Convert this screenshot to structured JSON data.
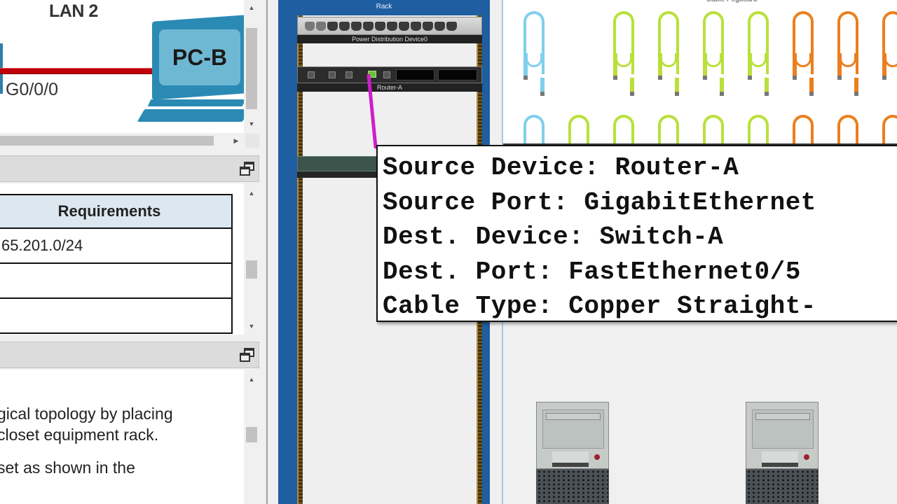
{
  "topology": {
    "lan_label": "LAN 2",
    "interface_label": "G0/0/0",
    "pc_label": "PC-B",
    "link_color": "#c0000a"
  },
  "addressing_panel": {
    "table": {
      "header": "Requirements",
      "rows": [
        "65.201.0/24",
        "",
        ""
      ]
    }
  },
  "instructions_panel": {
    "lines": [
      "gical topology by placing",
      "closet equipment rack.",
      "set as shown in the"
    ]
  },
  "rack": {
    "title": "Rack",
    "devices": [
      {
        "name": "Power Distribution Device0"
      },
      {
        "name": "Router-A"
      },
      {
        "name": ""
      }
    ],
    "cable_color": "#cc1fc8"
  },
  "pegboard": {
    "title": "Cable Pegboard",
    "row1_colors": [
      "#7fcfec",
      "",
      "#b9e03a",
      "#b9e03a",
      "#b9e03a",
      "#b9e03a",
      "#ec7f1d",
      "#ec7f1d",
      "#ec7f1d"
    ],
    "row2_colors": [
      "#7fcfec",
      "#b9e03a",
      "#b9e03a",
      "#b9e03a",
      "#b9e03a",
      "#b9e03a",
      "#ec7f1d",
      "#ec7f1d",
      "#ec7f1d"
    ]
  },
  "tooltip": {
    "source_device": "Source Device: Router-A",
    "source_port": "Source Port: GigabitEthernet",
    "dest_device": "Dest. Device: Switch-A",
    "dest_port": "Dest. Port: FastEthernet0/5",
    "cable_type": "Cable Type: Copper Straight-"
  },
  "icons": {
    "restore": "restore-window-icon",
    "scroll_up": "▲",
    "scroll_down": "▼",
    "scroll_right": "▶"
  }
}
